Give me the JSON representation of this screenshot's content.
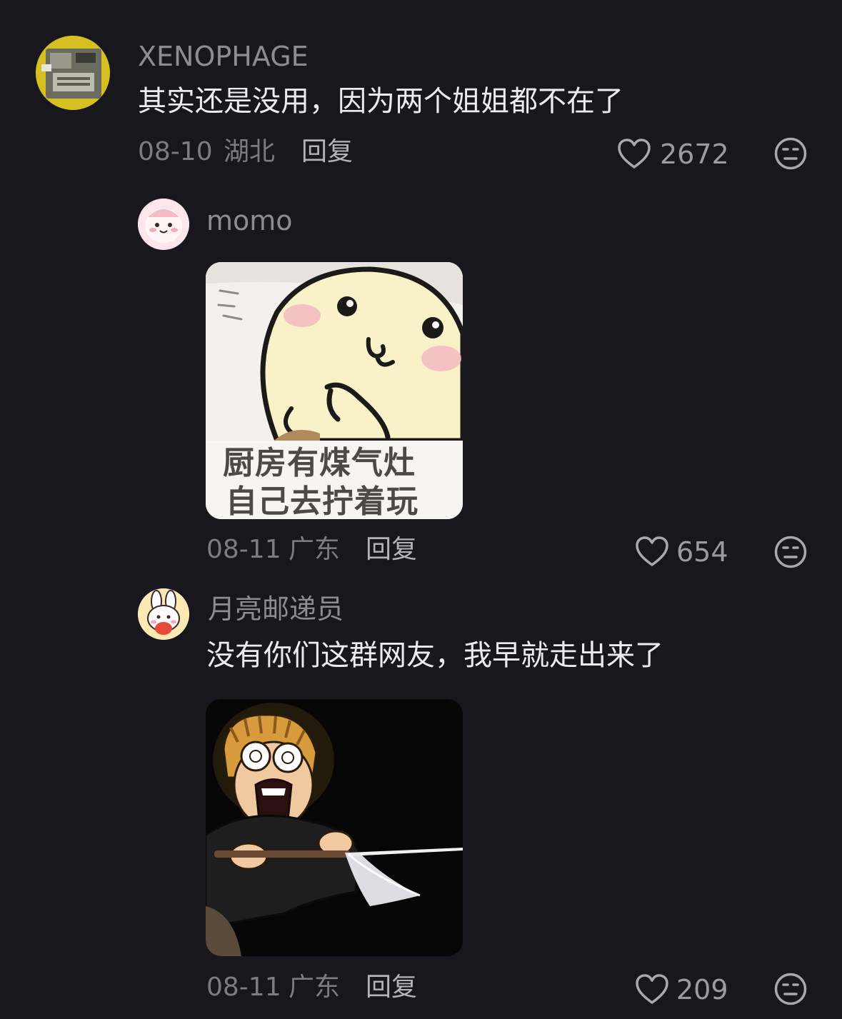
{
  "comments": [
    {
      "username": "XENOPHAGE",
      "text": "其实还是没用，因为两个姐姐都不在了",
      "date": "08-10",
      "location": "湖北",
      "reply_label": "回复",
      "likes": "2672",
      "avatar_icon": "device-photo-avatar",
      "avatar_accent": "#d8c11e"
    },
    {
      "username": "momo",
      "text": "",
      "date": "08-11",
      "location": "广东",
      "reply_label": "回复",
      "likes": "654",
      "avatar_icon": "pink-cartoon-face-avatar",
      "image": {
        "caption_line1": "厨房有煤气灶",
        "caption_line2": "自己去拧着玩"
      }
    },
    {
      "username": "月亮邮递员",
      "text": "没有你们这群网友，我早就走出来了",
      "date": "08-11",
      "location": "广东",
      "reply_label": "回复",
      "likes": "209",
      "avatar_icon": "bunny-sticker-avatar",
      "image": {
        "caption_line1": "",
        "caption_line2": ""
      }
    }
  ],
  "icons": {
    "like": "heart-outline-icon",
    "emoji": "neutral-face-icon"
  },
  "colors": {
    "background": "#18171d",
    "username": "#8d8c93",
    "text": "#ececef",
    "meta": "#7c7b82"
  }
}
